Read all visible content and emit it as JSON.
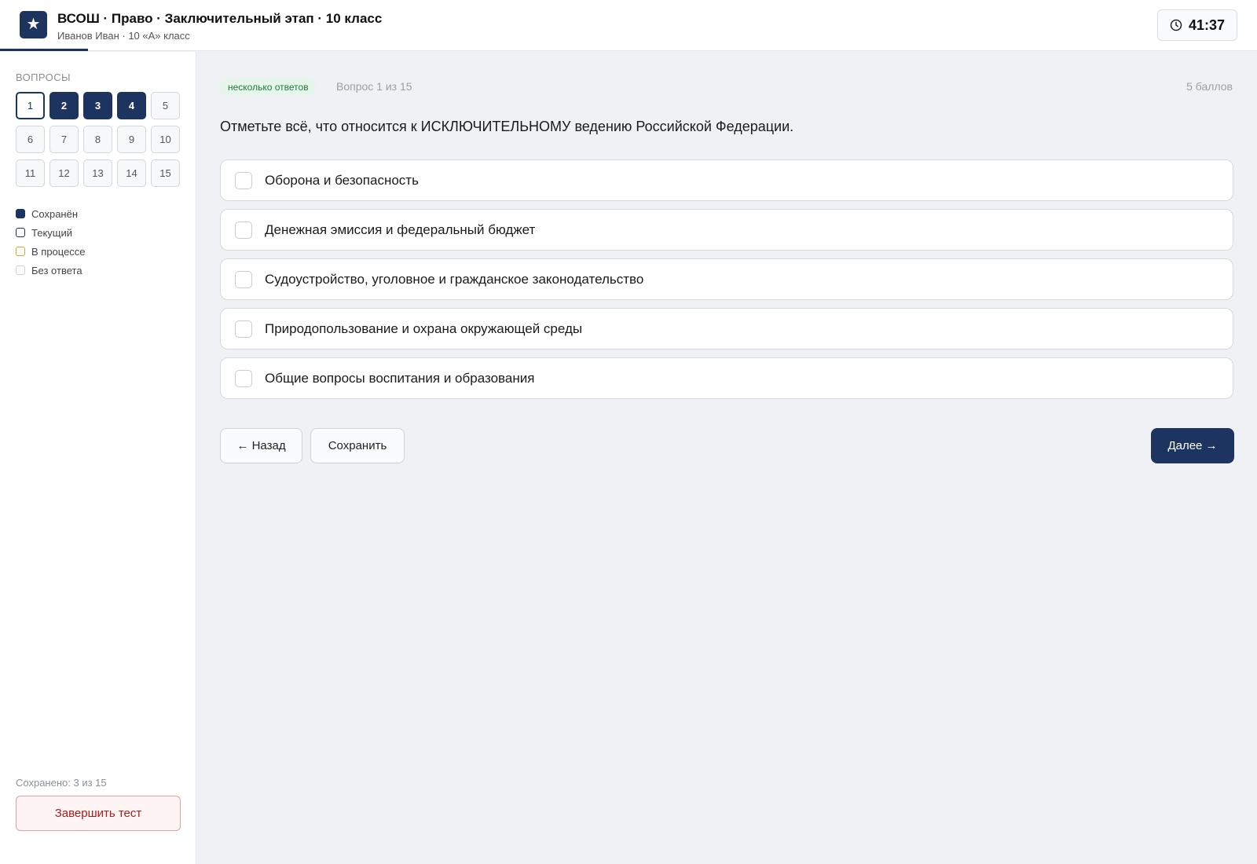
{
  "header": {
    "logo_glyph": "★",
    "title": "ВСОШ · Право · Заключительный этап · 10 класс",
    "subtitle": "Иванов Иван · 10 «А» класс",
    "timer": "41:37",
    "timer_icon": "clock-icon",
    "progress_fraction": 0.07
  },
  "sidebar": {
    "heading": "Вопросы",
    "questions": [
      {
        "label": "1",
        "state": "current"
      },
      {
        "label": "2",
        "state": "saved"
      },
      {
        "label": "3",
        "state": "saved"
      },
      {
        "label": "4",
        "state": "saved"
      },
      {
        "label": "5",
        "state": "unanswered"
      },
      {
        "label": "6",
        "state": "unanswered"
      },
      {
        "label": "7",
        "state": "unanswered"
      },
      {
        "label": "8",
        "state": "unanswered"
      },
      {
        "label": "9",
        "state": "unanswered"
      },
      {
        "label": "10",
        "state": "unanswered"
      },
      {
        "label": "11",
        "state": "unanswered"
      },
      {
        "label": "12",
        "state": "unanswered"
      },
      {
        "label": "13",
        "state": "unanswered"
      },
      {
        "label": "14",
        "state": "unanswered"
      },
      {
        "label": "15",
        "state": "unanswered"
      }
    ],
    "legend": {
      "saved": "Сохранён",
      "current": "Текущий",
      "in_progress": "В процессе",
      "unanswered": "Без ответа"
    },
    "saved_count": "Сохранено: 3 из 15",
    "finish_label": "Завершить тест"
  },
  "main": {
    "badge": "несколько ответов",
    "counter": "Вопрос 1 из 15",
    "points": "5 баллов",
    "question": "Отметьте всё, что относится к ИСКЛЮЧИТЕЛЬНОМУ ведению Российской Федерации.",
    "options": [
      {
        "label": "Оборона и безопасность",
        "checked": false
      },
      {
        "label": "Денежная эмиссия и федеральный бюджет",
        "checked": false
      },
      {
        "label": "Судоустройство, уголовное и гражданское законодательство",
        "checked": false
      },
      {
        "label": "Природопользование и охрана окружающей среды",
        "checked": false
      },
      {
        "label": "Общие вопросы воспитания и образования",
        "checked": false
      }
    ],
    "back_label": "← Назад",
    "save_label": "Сохранить",
    "next_label": "Далее →"
  },
  "colors": {
    "accent": "#1d3461",
    "in_progress": "#e0a32a",
    "danger": "#a32020",
    "badge_bg": "#e6f6ec",
    "badge_text": "#1e7a3c"
  }
}
